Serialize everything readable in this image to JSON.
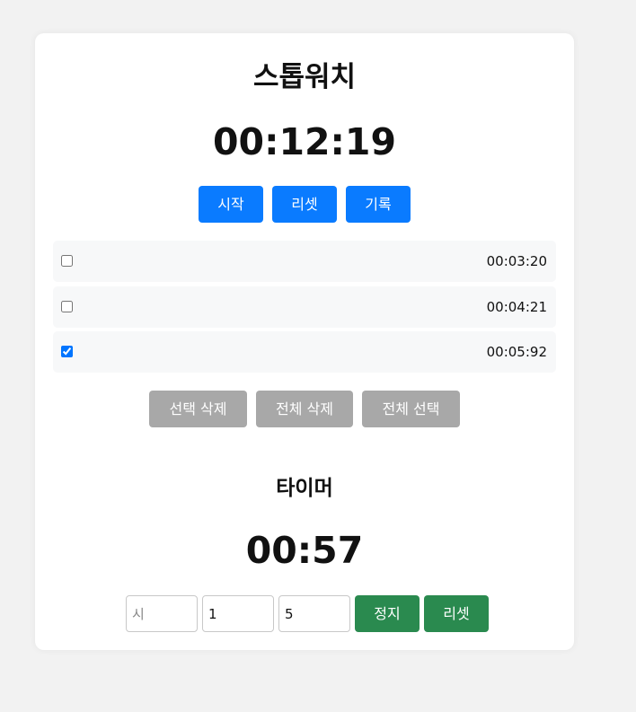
{
  "stopwatch": {
    "title": "스톱워치",
    "time": "00:12:19",
    "buttons": {
      "start": "시작",
      "reset": "리셋",
      "record": "기록"
    },
    "records": [
      {
        "time": "00:03:20",
        "checked": false
      },
      {
        "time": "00:04:21",
        "checked": false
      },
      {
        "time": "00:05:92",
        "checked": true
      }
    ],
    "record_actions": {
      "delete_selected": "선택 삭제",
      "delete_all": "전체 삭제",
      "select_all": "전체 선택"
    }
  },
  "timer": {
    "title": "타이머",
    "time": "00:57",
    "inputs": {
      "hours": {
        "placeholder": "시",
        "value": ""
      },
      "minutes": {
        "value": "1"
      },
      "seconds": {
        "value": "5"
      }
    },
    "buttons": {
      "stop": "정지",
      "reset": "리셋"
    }
  },
  "colors": {
    "primary": "#0a7bff",
    "secondary": "#a8a8a8",
    "success": "#2a8a4f"
  }
}
